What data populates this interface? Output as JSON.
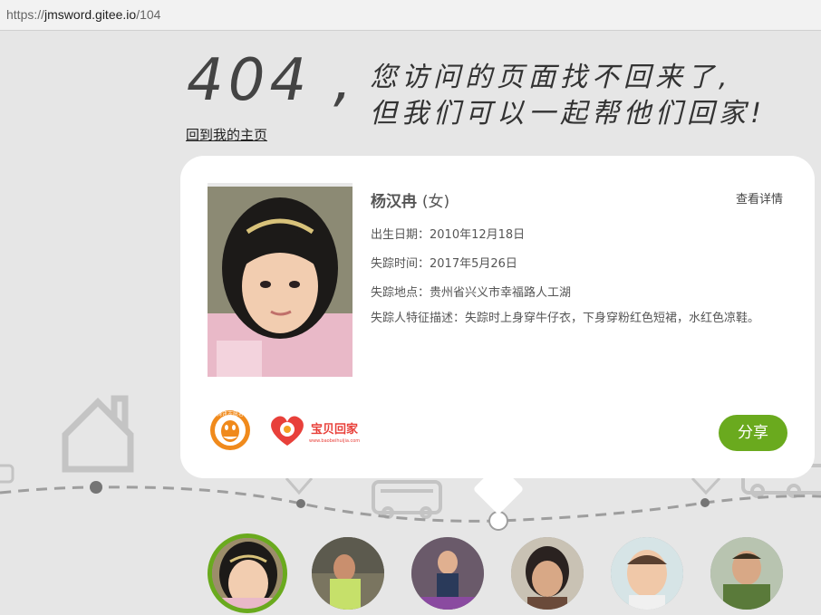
{
  "browser": {
    "url_scheme": "https://",
    "url_host": "jmsword.gitee.io",
    "url_path": "/104"
  },
  "heading": {
    "code": "404",
    "comma": ",",
    "line1": "您访问的页面找不回来了,",
    "line2": "但我们可以一起帮他们回家!"
  },
  "home_link": "回到我的主页",
  "child": {
    "name": "杨汉冉",
    "gender": "(女)",
    "detail_link": "查看详情",
    "birth": "出生日期：2010年12月18日",
    "lost_time": "失踪时间：2017年5月26日",
    "lost_place": "失踪地点：贵州省兴义市幸福路人工湖",
    "description": "失踪人特征描述：失踪时上身穿牛仔衣，下身穿粉红色短裙，水红色凉鞋。"
  },
  "logos": {
    "tencent": "腾讯志愿者",
    "baobei_name": "宝贝回家",
    "baobei_url": "www.baobeihuijia.com"
  },
  "share_label": "分享",
  "colors": {
    "accent_green": "#6aaa1e",
    "baobei_red": "#e8403a",
    "tencent_orange": "#f08a1c"
  },
  "thumbnails": [
    {
      "name": "thumb-1",
      "active": true
    },
    {
      "name": "thumb-2",
      "active": false
    },
    {
      "name": "thumb-3",
      "active": false
    },
    {
      "name": "thumb-4",
      "active": false
    },
    {
      "name": "thumb-5",
      "active": false
    },
    {
      "name": "thumb-6",
      "active": false
    }
  ]
}
